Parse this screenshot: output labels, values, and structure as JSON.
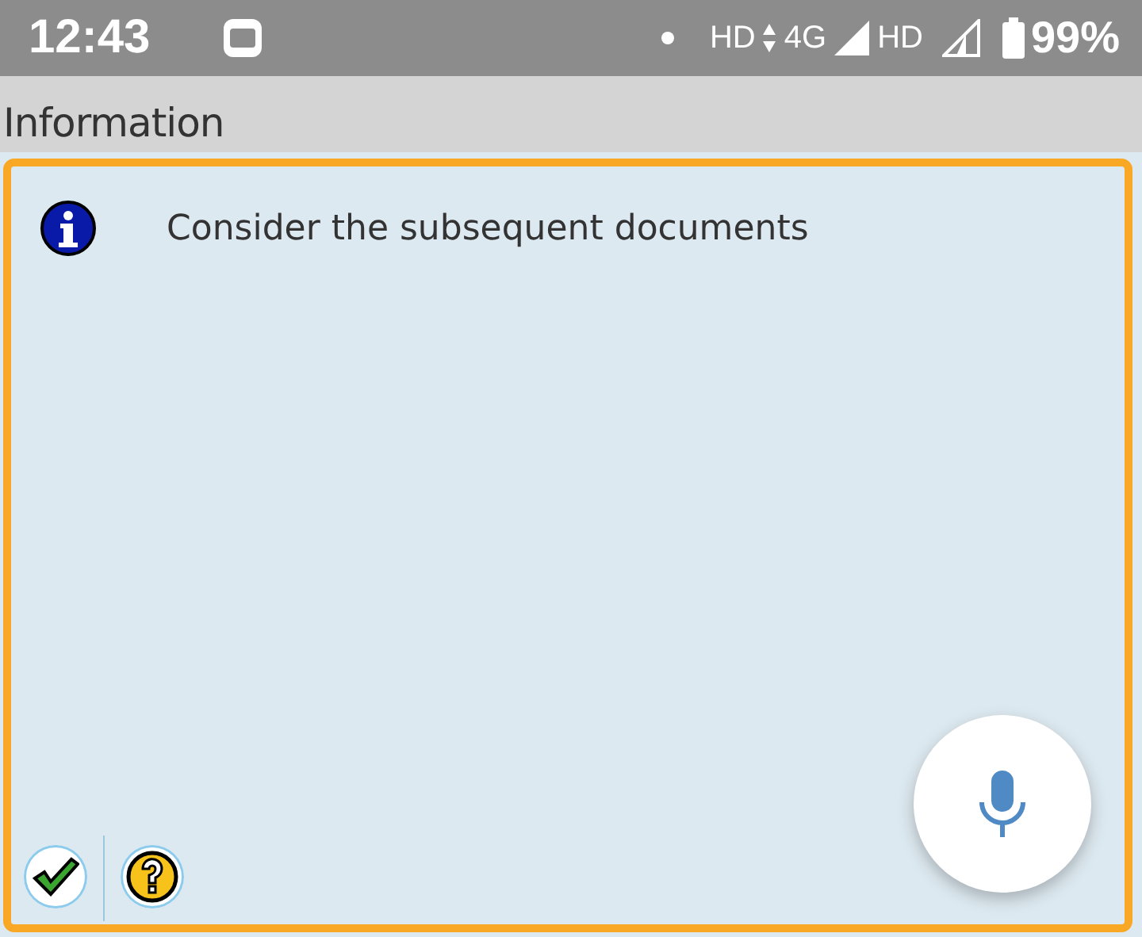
{
  "status_bar": {
    "time": "12:43",
    "network_1": "HD",
    "network_type": "4G",
    "network_2": "HD",
    "battery": "99%"
  },
  "header": {
    "title": "Information"
  },
  "message": {
    "text": "Consider the subsequent documents"
  }
}
